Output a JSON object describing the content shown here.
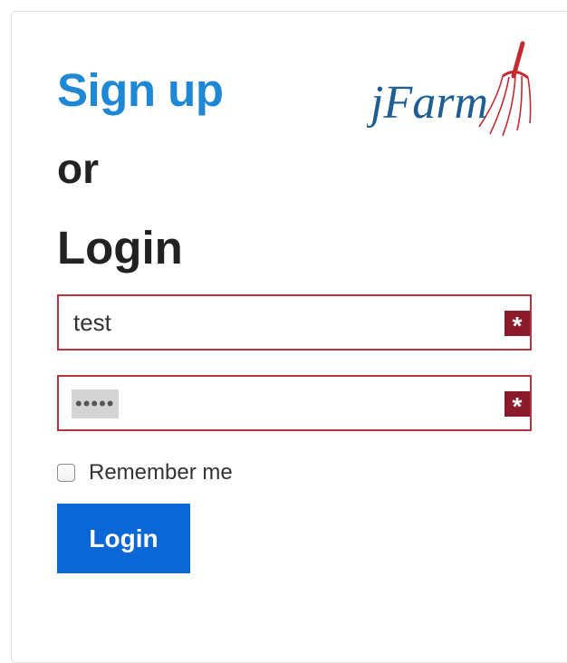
{
  "header": {
    "signup_link": "Sign up",
    "or_text": "or",
    "login_heading": "Login"
  },
  "logo": {
    "text": "jFarm",
    "icon": "pitchfork-icon",
    "text_color": "#1f5e92",
    "icon_color": "#c42a2f"
  },
  "form": {
    "username_value": "test",
    "password_value": "•••••",
    "required_marker": "*",
    "remember_label": "Remember me",
    "remember_checked": false,
    "login_button_label": "Login"
  },
  "colors": {
    "link": "#1e88d6",
    "field_border": "#b8343f",
    "required_marker_bg": "#8b1a2b",
    "button_bg": "#0b67d5"
  }
}
